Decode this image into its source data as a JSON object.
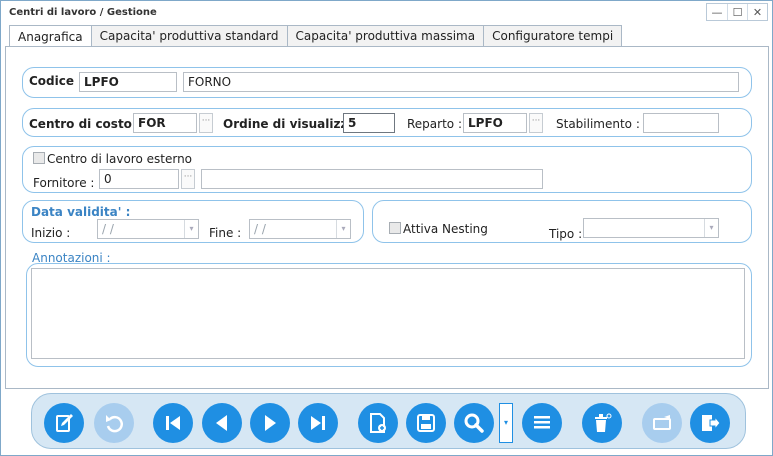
{
  "window": {
    "title": "Centri di lavoro / Gestione",
    "minimize": "—",
    "maximize": "☐",
    "close": "✕"
  },
  "tabs": [
    {
      "label": "Anagrafica",
      "active": true
    },
    {
      "label": "Capacita' produttiva standard",
      "active": false
    },
    {
      "label": "Capacita' produttiva massima",
      "active": false
    },
    {
      "label": "Configuratore tempi",
      "active": false
    }
  ],
  "codice": {
    "label": "Codice :",
    "code": "LPFO",
    "description": "FORNO"
  },
  "row2": {
    "centro_costo_label": "Centro di costo :",
    "centro_costo_value": "FOR",
    "ordine_label": "Ordine di visualizz. :",
    "ordine_value": "5",
    "reparto_label": "Reparto :",
    "reparto_value": "LPFO",
    "stabilimento_label": "Stabilimento :",
    "stabilimento_value": ""
  },
  "esterno": {
    "checkbox_label": "Centro di lavoro esterno",
    "fornitore_label": "Fornitore :",
    "fornitore_code": "0",
    "fornitore_desc": ""
  },
  "validita": {
    "title": "Data validita' :",
    "inizio_label": "Inizio :",
    "inizio_value": " / /",
    "fine_label": "Fine :",
    "fine_value": " / /"
  },
  "nesting": {
    "checkbox_label": "Attiva Nesting",
    "tipo_label": "Tipo :",
    "tipo_value": ""
  },
  "annotazioni": {
    "label": "Annotazioni :",
    "value": ""
  },
  "ellipsis": "···",
  "dropdown_glyph": "▾",
  "colors": {
    "accent": "#1f8fe3",
    "disabled": "#a8cdee",
    "toolbar_bg": "#d6e7f4",
    "border_blue": "#8fc3ea"
  },
  "toolbar_icons": [
    "edit-icon",
    "undo-icon",
    "first-icon",
    "previous-icon",
    "next-icon",
    "last-icon",
    "new-document-icon",
    "save-icon",
    "search-icon",
    "list-icon",
    "delete-icon",
    "print-icon",
    "exit-icon"
  ]
}
